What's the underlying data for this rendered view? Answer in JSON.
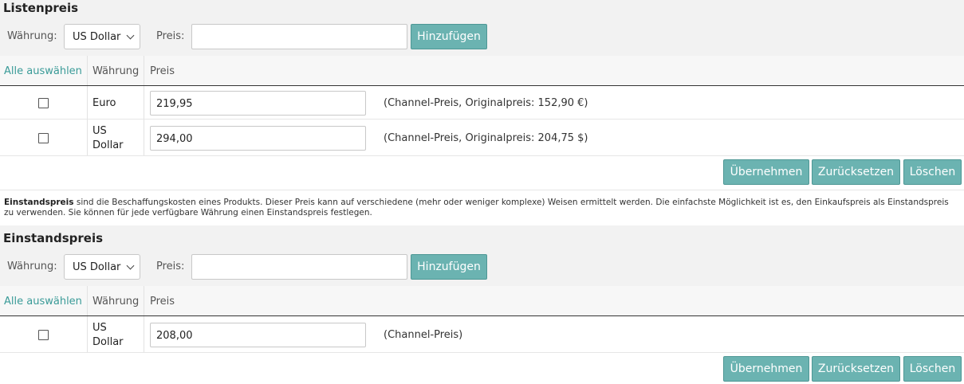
{
  "list_price": {
    "title": "Listenpreis",
    "currency_label": "Währung:",
    "currency_selected": "US Dollar",
    "price_label": "Preis:",
    "price_value": "",
    "add_button": "Hinzufügen",
    "headers": {
      "select_all": "Alle auswählen",
      "currency": "Währung",
      "price": "Preis"
    },
    "rows": [
      {
        "currency": "Euro",
        "price": "219,95",
        "note": "(Channel-Preis, Originalpreis: 152,90 €)"
      },
      {
        "currency": "US Dollar",
        "price": "294,00",
        "note": "(Channel-Preis, Originalpreis: 204,75 $)"
      }
    ],
    "actions": {
      "apply": "Übernehmen",
      "reset": "Zurücksetzen",
      "delete": "Löschen"
    }
  },
  "description": {
    "bold": "Einstandspreis",
    "text": " sind die Beschaffungskosten eines Produkts. Dieser Preis kann auf verschiedene (mehr oder weniger komplexe) Weisen ermittelt werden. Die einfachste Möglichkeit ist es, den Einkaufspreis als Einstandspreis zu verwenden. Sie können für jede verfügbare Währung einen Einstandspreis festlegen."
  },
  "cost_price": {
    "title": "Einstandspreis",
    "currency_label": "Währung:",
    "currency_selected": "US Dollar",
    "price_label": "Preis:",
    "price_value": "",
    "add_button": "Hinzufügen",
    "headers": {
      "select_all": "Alle auswählen",
      "currency": "Währung",
      "price": "Preis"
    },
    "rows": [
      {
        "currency": "US Dollar",
        "price": "208,00",
        "note": "(Channel-Preis)"
      }
    ],
    "actions": {
      "apply": "Übernehmen",
      "reset": "Zurücksetzen",
      "delete": "Löschen"
    }
  },
  "colors": {
    "accent": "#6bb3b1",
    "link": "#3a9b98",
    "header_bg": "#f2f2f2"
  }
}
